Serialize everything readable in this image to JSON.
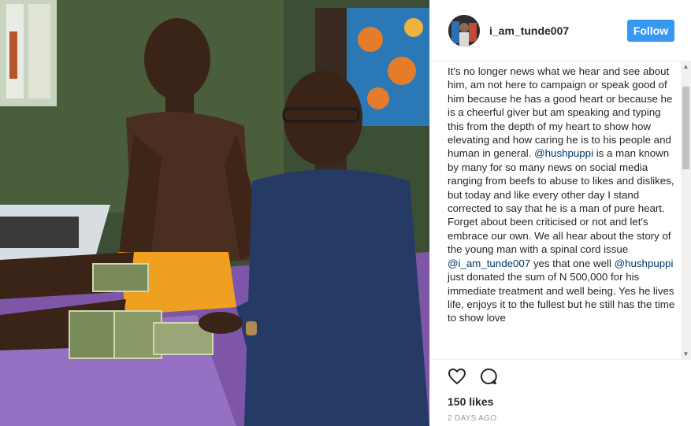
{
  "post": {
    "username": "i_am_tunde007",
    "follow_label": "Follow",
    "caption": {
      "t1": "It's no longer news what we hear and see about him, am not here to campaign or speak good of him because he has a good heart or because he is a cheerful giver but am speaking and typing this from the depth of my heart to show how elevating and how caring he is to his people and human in general. ",
      "m1": "@hushpuppi",
      "t2": " is a man known by many for so many news on social media ranging from beefs to abuse to likes and dislikes, but today and like every other day I stand corrected to say that he is a man of pure heart. Forget about been criticised or not and let's embrace our own. We all hear about the story of the young man with a spinal cord issue ",
      "m2": "@i_am_tunde007",
      "t3": " yes that one well ",
      "m3": "@hushpuppi",
      "t4": " just donated the sum of N 500,000 for his immediate treatment and well being. Yes he lives life, enjoys it to the fullest but he still has the time to show love"
    },
    "likes": "150 likes",
    "timestamp": "2 DAYS AGO"
  },
  "icons": {
    "like": "heart-icon",
    "comment": "comment-icon",
    "scroll_up": "scroll-up-arrow-icon",
    "scroll_down": "scroll-down-arrow-icon"
  },
  "colors": {
    "follow_button": "#3897f0",
    "mention": "#003569",
    "text": "#262626",
    "muted": "#999999"
  }
}
